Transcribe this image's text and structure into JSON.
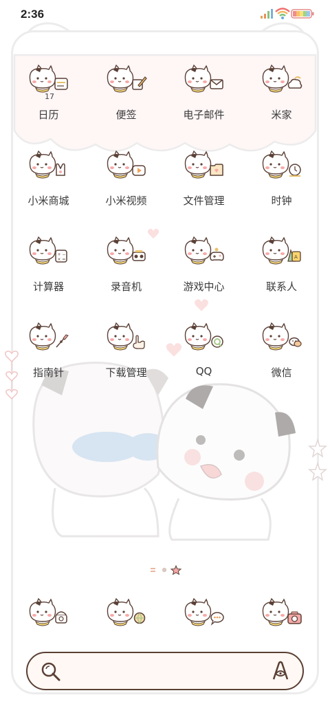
{
  "status_bar": {
    "time": "2:36",
    "icons": [
      "signal-icon",
      "wifi-icon",
      "battery-icon"
    ]
  },
  "apps": [
    {
      "label": "日历",
      "icon": "calendar-icon",
      "badge": "17"
    },
    {
      "label": "便签",
      "icon": "notes-icon"
    },
    {
      "label": "电子邮件",
      "icon": "mail-icon"
    },
    {
      "label": "米家",
      "icon": "mijia-icon"
    },
    {
      "label": "小米商城",
      "icon": "mi-store-icon"
    },
    {
      "label": "小米视频",
      "icon": "mi-video-icon"
    },
    {
      "label": "文件管理",
      "icon": "file-manager-icon"
    },
    {
      "label": "时钟",
      "icon": "clock-icon"
    },
    {
      "label": "计算器",
      "icon": "calculator-icon"
    },
    {
      "label": "录音机",
      "icon": "recorder-icon"
    },
    {
      "label": "游戏中心",
      "icon": "game-center-icon"
    },
    {
      "label": "联系人",
      "icon": "contacts-icon"
    },
    {
      "label": "指南针",
      "icon": "compass-icon"
    },
    {
      "label": "下载管理",
      "icon": "download-manager-icon"
    },
    {
      "label": "QQ",
      "icon": "qq-icon"
    },
    {
      "label": "微信",
      "icon": "wechat-icon"
    }
  ],
  "pager": {
    "pages": 3,
    "current": 3
  },
  "dock": [
    {
      "icon": "phone-icon"
    },
    {
      "icon": "browser-icon"
    },
    {
      "icon": "messages-icon"
    },
    {
      "icon": "camera-icon"
    }
  ],
  "colors": {
    "cat_outline": "#5a4036",
    "blush": "#f7a9a8",
    "accent_brown": "#5a3f33",
    "badge_gold": "#e8c06a",
    "frame": "#ececec",
    "search_bg": "#fff8f4"
  }
}
